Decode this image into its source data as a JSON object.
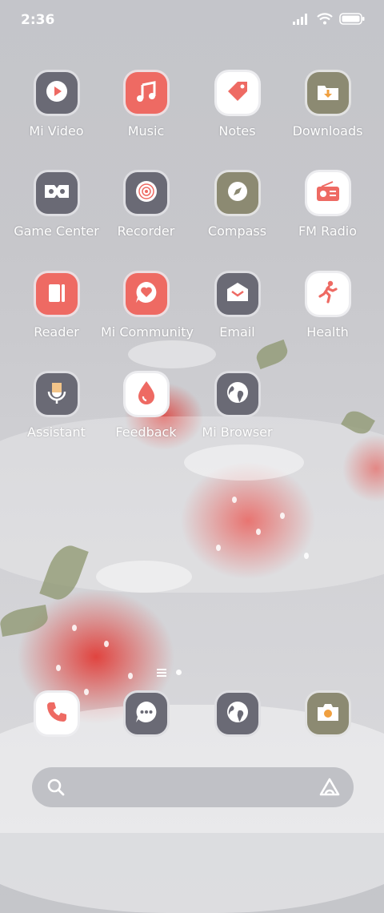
{
  "status_bar": {
    "time": "2:36"
  },
  "colors": {
    "coral": "#ee6a63",
    "slate": "#6a6a75",
    "olive": "#8c8a72",
    "white": "#ffffff"
  },
  "apps": [
    {
      "label": "Mi Video",
      "icon": "play-icon",
      "tile": "slate"
    },
    {
      "label": "Music",
      "icon": "music-note-icon",
      "tile": "coral"
    },
    {
      "label": "Notes",
      "icon": "tag-icon",
      "tile": "white"
    },
    {
      "label": "Downloads",
      "icon": "folder-download-icon",
      "tile": "olive"
    },
    {
      "label": "Game Center",
      "icon": "gamepad-icon",
      "tile": "slate"
    },
    {
      "label": "Recorder",
      "icon": "record-disc-icon",
      "tile": "slate"
    },
    {
      "label": "Compass",
      "icon": "compass-icon",
      "tile": "olive"
    },
    {
      "label": "FM Radio",
      "icon": "radio-icon",
      "tile": "white"
    },
    {
      "label": "Reader",
      "icon": "book-icon",
      "tile": "coral"
    },
    {
      "label": "Mi Community",
      "icon": "heart-chat-icon",
      "tile": "coral"
    },
    {
      "label": "Email",
      "icon": "mail-icon",
      "tile": "slate"
    },
    {
      "label": "Health",
      "icon": "running-icon",
      "tile": "white"
    },
    {
      "label": "Assistant",
      "icon": "microphone-icon",
      "tile": "slate"
    },
    {
      "label": "Feedback",
      "icon": "drop-icon",
      "tile": "white"
    },
    {
      "label": "Mi Browser",
      "icon": "globe-icon",
      "tile": "slate"
    }
  ],
  "dock": [
    {
      "name": "Phone",
      "icon": "phone-icon",
      "tile": "white"
    },
    {
      "name": "Messages",
      "icon": "chat-icon",
      "tile": "slate"
    },
    {
      "name": "Browser",
      "icon": "globe-icon",
      "tile": "slate"
    },
    {
      "name": "Camera",
      "icon": "camera-icon",
      "tile": "olive"
    }
  ],
  "page_indicator": {
    "pages": 2,
    "current": 2
  },
  "search_bar": {
    "left_icon": "search-icon",
    "right_icon": "assistant-icon"
  }
}
